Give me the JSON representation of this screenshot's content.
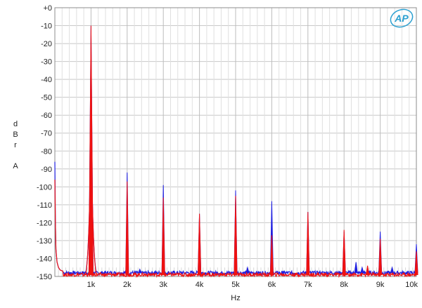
{
  "chart_data": {
    "type": "line",
    "xlabel": "Hz",
    "ylabel_lines": [
      "d",
      "B",
      "r",
      "",
      "A"
    ],
    "xlim": [
      0,
      10000
    ],
    "ylim": [
      -150,
      0
    ],
    "y_ticks": [
      0,
      -10,
      -20,
      -30,
      -40,
      -50,
      -60,
      -70,
      -80,
      -90,
      -100,
      -110,
      -120,
      -130,
      -140,
      -150
    ],
    "y_tick_labels": [
      "+0",
      "-10",
      "-20",
      "-30",
      "-40",
      "-50",
      "-60",
      "-70",
      "-80",
      "-90",
      "-100",
      "-110",
      "-120",
      "-130",
      "-140",
      "-150"
    ],
    "x_ticks": [
      1000,
      2000,
      3000,
      4000,
      5000,
      6000,
      7000,
      8000,
      9000,
      10000
    ],
    "x_tick_labels": [
      "1k",
      "2k",
      "3k",
      "4k",
      "5k",
      "6k",
      "7k",
      "8k",
      "9k",
      "10k"
    ],
    "x_minor_step": 200,
    "y_minor_step": 5,
    "grid": true,
    "logo_text": "AP",
    "colors": {
      "blue": "#1f1fe0",
      "red": "#ee1111",
      "grid": "#c8c8c8",
      "logo": "#2a9fd0"
    },
    "series": [
      {
        "color": "blue",
        "noise_floor": -148,
        "lowfreq_start": -86,
        "peaks": [
          {
            "x": 1000,
            "y": -10
          },
          {
            "x": 2000,
            "y": -92
          },
          {
            "x": 3000,
            "y": -99
          },
          {
            "x": 4000,
            "y": -115
          },
          {
            "x": 5000,
            "y": -102
          },
          {
            "x": 6000,
            "y": -108
          },
          {
            "x": 7000,
            "y": -114
          },
          {
            "x": 8000,
            "y": -125
          },
          {
            "x": 9000,
            "y": -125
          },
          {
            "x": 10000,
            "y": -132
          },
          {
            "x": 2350,
            "y": -146
          },
          {
            "x": 5330,
            "y": -145
          },
          {
            "x": 6330,
            "y": -147
          },
          {
            "x": 8330,
            "y": -142
          },
          {
            "x": 8500,
            "y": -145
          },
          {
            "x": 9330,
            "y": -145
          }
        ]
      },
      {
        "color": "red",
        "noise_floor": -149,
        "lowfreq_start": -96,
        "peaks": [
          {
            "x": 1000,
            "y": -10
          },
          {
            "x": 2000,
            "y": -97
          },
          {
            "x": 3000,
            "y": -106
          },
          {
            "x": 4000,
            "y": -115
          },
          {
            "x": 5000,
            "y": -105
          },
          {
            "x": 6000,
            "y": -127
          },
          {
            "x": 7000,
            "y": -114
          },
          {
            "x": 8000,
            "y": -124
          },
          {
            "x": 9000,
            "y": -129
          },
          {
            "x": 10000,
            "y": -136
          },
          {
            "x": 8650,
            "y": -144
          }
        ]
      }
    ]
  }
}
